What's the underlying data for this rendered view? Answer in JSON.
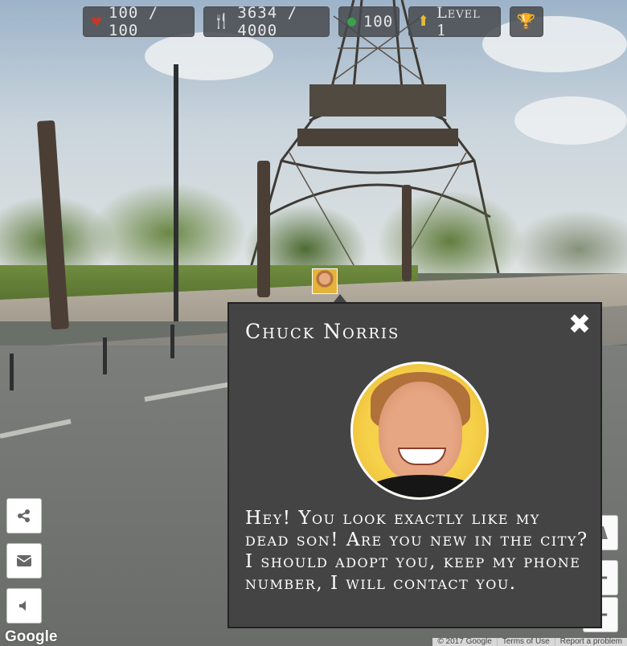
{
  "hud": {
    "health": "100 / 100",
    "food": "3634 / 4000",
    "money": "100",
    "level": "Level 1",
    "icons": [
      "heart-icon",
      "fork-knife-icon",
      "money-bag-icon",
      "arrow-up-icon",
      "trophy-icon"
    ],
    "colors": {
      "heart": "#c0392b",
      "food": "#7aa7d6",
      "money": "#3aa34a",
      "level": "#e8b93a",
      "trophy": "#e8b93a"
    }
  },
  "dialog": {
    "name": "Chuck Norris",
    "message": "Hey! You look exactly like my dead son! Are you new in the city? I should adopt you, keep my phone number, I will contact you.",
    "close_icon": "✖"
  },
  "side_buttons": {
    "left": [
      "share-icon",
      "envelope-icon",
      "sound-icon"
    ],
    "right": [
      "road-icon",
      "zoom-in-icon",
      "zoom-out-icon"
    ]
  },
  "map": {
    "logo": "Google",
    "copyright": "© 2017 Google",
    "terms": "Terms of Use",
    "report": "Report a problem"
  }
}
